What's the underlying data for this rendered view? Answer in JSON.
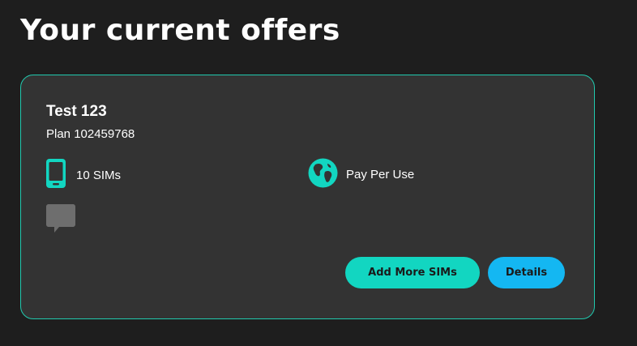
{
  "header": {
    "title": "Your current offers"
  },
  "offer": {
    "name": "Test 123",
    "plan": "Plan 102459768",
    "features": {
      "sims": "10 SIMs",
      "usage": "Pay Per Use"
    },
    "buttons": {
      "add_more": "Add More SIMs",
      "details": "Details"
    }
  },
  "icons": {
    "sims": "phone-icon",
    "usage": "globe-icon",
    "chat": "chat-bubble-icon"
  },
  "colors": {
    "accent_teal": "#12d6c1",
    "accent_blue": "#14b7f2",
    "card_border": "#21c9ae",
    "card_bg": "#333333",
    "page_bg": "#1e1e1e",
    "muted_icon": "#6e6e6e"
  }
}
